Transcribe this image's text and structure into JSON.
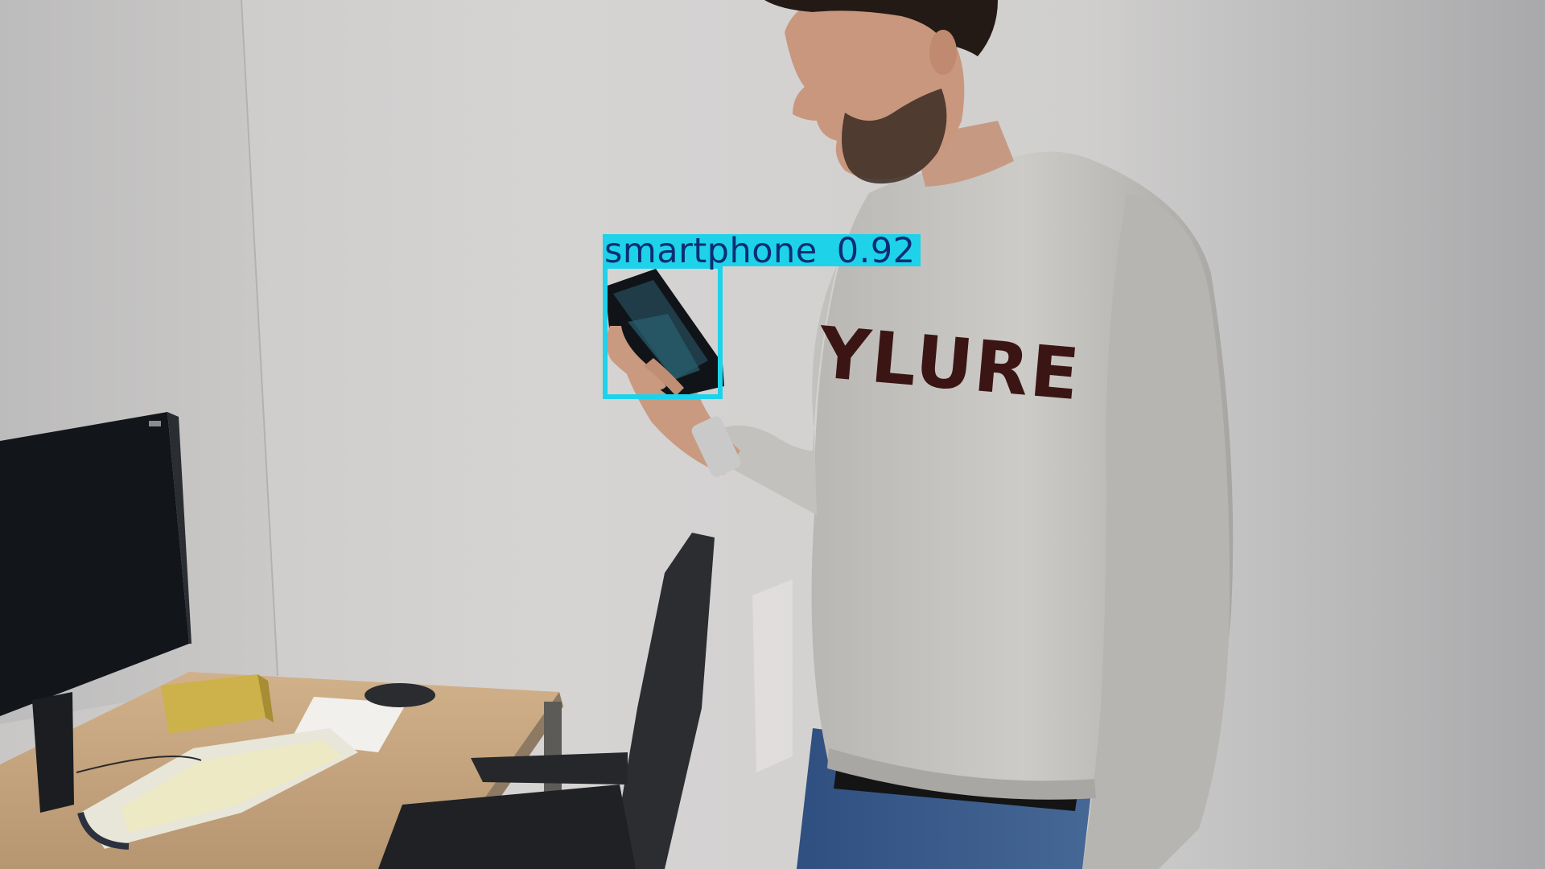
{
  "image": {
    "description_none": "",
    "colors": {
      "wall": "#d2d1d0",
      "sweater": "#c6c4c0",
      "desk": "#c8a882",
      "monitor": "#111418",
      "chair": "#2a2c30",
      "jeans": "#3a5a8c",
      "box_color": "#1ed2ea",
      "label_text": "#0b2e73"
    }
  },
  "detections": [
    {
      "class_name": "smartphone",
      "confidence": "0.92"
    }
  ],
  "sweater_print": "YLURE"
}
